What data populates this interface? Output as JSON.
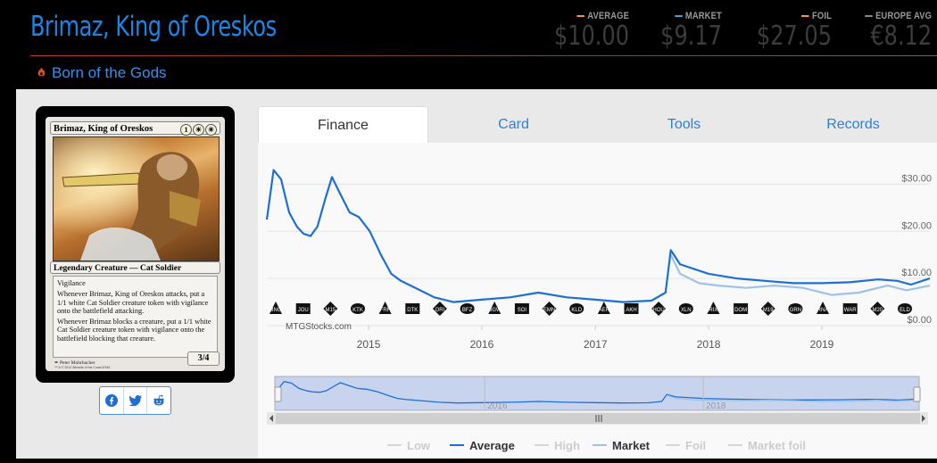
{
  "header": {
    "card_name": "Brimaz, King of Oreskos",
    "set_name": "Born of the Gods",
    "prices": [
      {
        "label": "AVERAGE",
        "value": "$10.00",
        "color": "#f0a020"
      },
      {
        "label": "MARKET",
        "value": "$9.17",
        "color": "#4aa0c8"
      },
      {
        "label": "FOIL",
        "value": "$27.05",
        "color": "#f0a020"
      },
      {
        "label": "EUROPE AVG",
        "value": "€8.12",
        "color": "#8a8a8a"
      }
    ]
  },
  "card_image": {
    "name": "Brimaz, King of Oreskos",
    "mana_cost": [
      "1",
      "W",
      "W"
    ],
    "type_line": "Legendary Creature — Cat Soldier",
    "rules_text": [
      "Vigilance",
      "Whenever Brimaz, King of Oreskos attacks, put a 1/1 white Cat Soldier creature token with vigilance onto the battlefield attacking.",
      "Whenever Brimaz blocks a creature, put a 1/1 white Cat Soldier creature token with vigilance onto the battlefield blocking that creature."
    ],
    "power_toughness": "3/4",
    "artist": "Peter Mohrbacher",
    "copyright": "™ & © 2014 Wizards of the Coast 5/165"
  },
  "share": [
    "facebook-icon",
    "twitter-icon",
    "reddit-icon"
  ],
  "tabs": [
    {
      "label": "Finance",
      "active": true
    },
    {
      "label": "Card",
      "active": false
    },
    {
      "label": "Tools",
      "active": false
    },
    {
      "label": "Records",
      "active": false
    }
  ],
  "chart_data": {
    "type": "line",
    "credit": "MTGStocks.com",
    "x_ticks": [
      "2015",
      "2016",
      "2017",
      "2018",
      "2019"
    ],
    "y_ticks": [
      "$30.00",
      "$20.00",
      "$10.00",
      "$0.00"
    ],
    "ylim": [
      0,
      35
    ],
    "xlim": [
      "2014-02-07",
      "2019-12-15"
    ],
    "series": [
      {
        "name": "Average",
        "color": "#1f6fd2",
        "points": [
          [
            "2014-02-07",
            22.5
          ],
          [
            "2014-03-01",
            33
          ],
          [
            "2014-03-25",
            31
          ],
          [
            "2014-04-20",
            24
          ],
          [
            "2014-05-15",
            21
          ],
          [
            "2014-06-05",
            19.5
          ],
          [
            "2014-06-28",
            19
          ],
          [
            "2014-07-20",
            21
          ],
          [
            "2014-08-15",
            27
          ],
          [
            "2014-09-05",
            31.5
          ],
          [
            "2014-10-01",
            28
          ],
          [
            "2014-11-01",
            24
          ],
          [
            "2014-12-01",
            23
          ],
          [
            "2015-01-05",
            20
          ],
          [
            "2015-02-10",
            15
          ],
          [
            "2015-03-15",
            11
          ],
          [
            "2015-04-15",
            9.5
          ],
          [
            "2015-06-01",
            8
          ],
          [
            "2015-08-01",
            6
          ],
          [
            "2015-10-01",
            5
          ],
          [
            "2016-01-01",
            5.5
          ],
          [
            "2016-04-01",
            6
          ],
          [
            "2016-07-01",
            7
          ],
          [
            "2016-10-01",
            6
          ],
          [
            "2017-01-01",
            5.5
          ],
          [
            "2017-04-01",
            5
          ],
          [
            "2017-07-01",
            5.3
          ],
          [
            "2017-08-15",
            7
          ],
          [
            "2017-09-01",
            16
          ],
          [
            "2017-10-01",
            13
          ],
          [
            "2018-01-01",
            11
          ],
          [
            "2018-04-01",
            10
          ],
          [
            "2018-07-01",
            9.5
          ],
          [
            "2018-10-01",
            9
          ],
          [
            "2019-01-01",
            9
          ],
          [
            "2019-04-01",
            9.2
          ],
          [
            "2019-07-01",
            9.8
          ],
          [
            "2019-09-01",
            9.5
          ],
          [
            "2019-10-15",
            8.7
          ],
          [
            "2019-12-15",
            10
          ]
        ]
      },
      {
        "name": "Market",
        "color": "#9ec3e8",
        "points": [
          [
            "2017-09-01",
            15
          ],
          [
            "2017-10-01",
            11
          ],
          [
            "2017-12-01",
            9
          ],
          [
            "2018-02-01",
            8.5
          ],
          [
            "2018-05-01",
            8
          ],
          [
            "2018-08-01",
            8.5
          ],
          [
            "2018-11-01",
            8
          ],
          [
            "2019-02-01",
            6.5
          ],
          [
            "2019-05-01",
            7
          ],
          [
            "2019-08-01",
            8.5
          ],
          [
            "2019-10-01",
            7.5
          ],
          [
            "2019-12-15",
            8.5
          ]
        ]
      }
    ],
    "legend": [
      {
        "label": "Low",
        "color": "#d6d6d6",
        "active": false
      },
      {
        "label": "Average",
        "color": "#1f6fd2",
        "active": true
      },
      {
        "label": "High",
        "color": "#d6d6d6",
        "active": false
      },
      {
        "label": "Market",
        "color": "#9ec3e8",
        "active": true
      },
      {
        "label": "Foil",
        "color": "#d6d6d6",
        "active": false
      },
      {
        "label": "Market foil",
        "color": "#d6d6d6",
        "active": false
      }
    ],
    "navigator_ticks": [
      "2016",
      "2018"
    ],
    "set_symbols": [
      "BNG",
      "JOU",
      "M15",
      "KTK",
      "FRF",
      "DTK",
      "ORI",
      "BFZ",
      "OGW",
      "SOI",
      "EMN",
      "KLD",
      "AER",
      "AKH",
      "HOU",
      "XLN",
      "RIX",
      "DOM",
      "M19",
      "GRN",
      "RNA",
      "WAR",
      "M20",
      "ELD"
    ]
  }
}
